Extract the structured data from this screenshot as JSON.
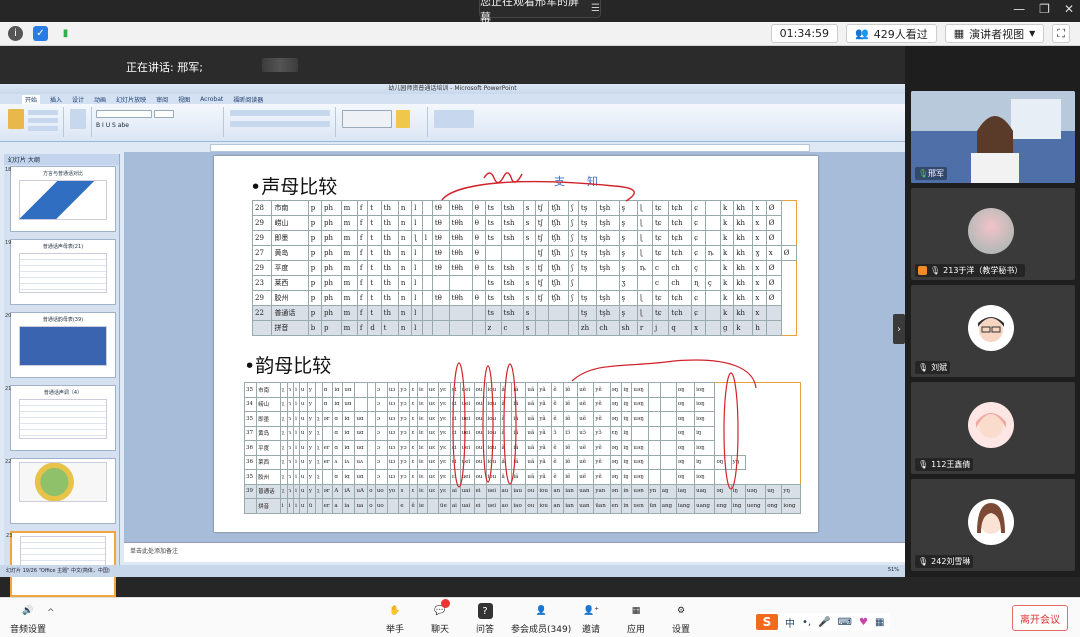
{
  "banner": {
    "text": "您正在观看邢军的屏幕"
  },
  "toolbar": {
    "timer": "01:34:59",
    "viewers": "429人看过",
    "view_mode": "演讲者视图"
  },
  "speaking": {
    "text": "正在讲话: 邢军;"
  },
  "ppt": {
    "window_title": "幼儿园师资普通话培训 - Microsoft PowerPoint",
    "tabs": [
      "开始",
      "插入",
      "设计",
      "动画",
      "幻灯片放映",
      "审阅",
      "视图",
      "Acrobat",
      "福昕阅读器"
    ],
    "pane_tabs": "幻灯片 大纲",
    "thumbnails": [
      {
        "num": "18",
        "title": "方言与普通话对比"
      },
      {
        "num": "19",
        "title": "普通话声母表(21)"
      },
      {
        "num": "20",
        "title": "普通话韵母表(39)"
      },
      {
        "num": "21",
        "title": "普通话声调（4）"
      },
      {
        "num": "22",
        "title": ""
      },
      {
        "num": "23",
        "title": ""
      }
    ],
    "notes": "单击此处添加备注",
    "status_left": "幻灯片 19/26   \"Office 主题\"   中文(简体，中国)",
    "status_right": "51%",
    "slide": {
      "title1": "•声母比较",
      "title2": "•韵母比较",
      "annot_zhi": "支",
      "annot_zhi2": "知",
      "table1": [
        [
          "28",
          "市南",
          "p",
          "ph",
          "m",
          "f",
          "t",
          "th",
          "n",
          "l",
          "",
          "tθ",
          "tθh",
          "θ",
          "ts",
          "tsh",
          "s",
          "tʃ",
          "tʃh",
          "ʃ",
          "tş",
          "tşh",
          "ş",
          "ɭ",
          "tɕ",
          "tɕh",
          "ɕ",
          "",
          "k",
          "kh",
          "x",
          "Ø"
        ],
        [
          "29",
          "崂山",
          "p",
          "ph",
          "m",
          "f",
          "t",
          "th",
          "n",
          "l",
          "",
          "tθ",
          "tθh",
          "θ",
          "ts",
          "tsh",
          "s",
          "tʃ",
          "tʃh",
          "ʃ",
          "tş",
          "tşh",
          "ş",
          "ɭ",
          "tɕ",
          "tɕh",
          "ɕ",
          "",
          "k",
          "kh",
          "x",
          "Ø"
        ],
        [
          "29",
          "即墨",
          "p",
          "ph",
          "m",
          "f",
          "t",
          "th",
          "n",
          "ɭ",
          "l",
          "tθ",
          "tθh",
          "θ",
          "ts",
          "tsh",
          "s",
          "tʃ",
          "tʃh",
          "ʃ",
          "tş",
          "tşh",
          "ş",
          "ɭ",
          "tɕ",
          "tɕh",
          "ɕ",
          "",
          "k",
          "kh",
          "x",
          "Ø"
        ],
        [
          "27",
          "黄岛",
          "p",
          "ph",
          "m",
          "f",
          "t",
          "th",
          "n",
          "l",
          "",
          "tθ",
          "tθh",
          "θ",
          "",
          "",
          "",
          "tʃ",
          "tʃh",
          "ʃ",
          "tş",
          "tşh",
          "ş",
          "ɭ",
          "tɕ",
          "tɕh",
          "ɕ",
          "ȵ",
          "k",
          "kh",
          "ɣ",
          "x",
          "Ø"
        ],
        [
          "29",
          "平度",
          "p",
          "ph",
          "m",
          "f",
          "t",
          "th",
          "n",
          "l",
          "",
          "tθ",
          "tθh",
          "θ",
          "ts",
          "tsh",
          "s",
          "tʃ",
          "tʃh",
          "ʃ",
          "tş",
          "tşh",
          "ş",
          "ȵ",
          "c",
          "ch",
          "ç",
          "",
          "k",
          "kh",
          "x",
          "Ø"
        ],
        [
          "23",
          "莱西",
          "p",
          "ph",
          "m",
          "f",
          "t",
          "th",
          "n",
          "l",
          "",
          "",
          "",
          "",
          "ts",
          "tsh",
          "s",
          "tʃ",
          "tʃh",
          "ʃ",
          "",
          "",
          "ʒ",
          "",
          "c",
          "ch",
          "ɳ",
          "ç",
          "k",
          "kh",
          "x",
          "Ø"
        ],
        [
          "29",
          "胶州",
          "p",
          "ph",
          "m",
          "f",
          "t",
          "th",
          "n",
          "l",
          "",
          "tθ",
          "tθh",
          "θ",
          "ts",
          "tsh",
          "s",
          "tʃ",
          "tʃh",
          "ʃ",
          "tş",
          "tşh",
          "ş",
          "ɭ",
          "tɕ",
          "tɕh",
          "ɕ",
          "",
          "k",
          "kh",
          "x",
          "Ø"
        ],
        [
          "22",
          "普通话",
          "p",
          "ph",
          "m",
          "f",
          "t",
          "th",
          "n",
          "l",
          "",
          "",
          "",
          "",
          "ts",
          "tsh",
          "s",
          "",
          "",
          "",
          "tş",
          "tşh",
          "ş",
          "ɭ",
          "tɕ",
          "tɕh",
          "ɕ",
          "",
          "k",
          "kh",
          "x",
          ""
        ],
        [
          "",
          "拼音",
          "b",
          "p",
          "m",
          "f",
          "d",
          "t",
          "n",
          "l",
          "",
          "",
          "",
          "",
          "z",
          "c",
          "s",
          "",
          "",
          "",
          "zh",
          "ch",
          "sh",
          "r",
          "j",
          "q",
          "x",
          "",
          "g",
          "k",
          "h",
          ""
        ]
      ],
      "table2": [
        [
          "35",
          "市南",
          "ʅ",
          "ɿ",
          "i",
          "u",
          "y",
          "",
          "ɑ",
          "iɑ",
          "uɑ",
          "",
          "",
          "ɔ",
          "uɔ",
          "yɔ",
          "ɛ",
          "iɛ",
          "uɛ",
          "yɛ",
          "ɛi",
          "uei",
          "ou",
          "iou",
          "ã",
          "iã",
          "uã",
          "yã",
          "ẽ",
          "iẽ",
          "uẽ",
          "yẽ",
          "əŋ",
          "iŋ",
          "uəŋ",
          "",
          "",
          "oŋ",
          "ioŋ"
        ],
        [
          "34",
          "崂山",
          "ʅ",
          "ɿ",
          "i",
          "u",
          "y",
          "",
          "ɑ",
          "iɑ",
          "uɑ",
          "",
          "",
          "ɔ",
          "uɔ",
          "yɔ",
          "ɛ",
          "iɛ",
          "uɛ",
          "yɛ",
          "ɛi",
          "uei",
          "ou",
          "iou",
          "ã",
          "iã",
          "uã",
          "yã",
          "ẽ",
          "iẽ",
          "uẽ",
          "yẽ",
          "əŋ",
          "iŋ",
          "uəŋ",
          "",
          "",
          "oŋ",
          "ioŋ"
        ],
        [
          "35",
          "即墨",
          "ʅ",
          "ɿ",
          "i",
          "u",
          "y",
          "ʅ",
          "ər",
          "ɑ",
          "iɑ",
          "uɑ",
          "",
          "ɔ",
          "uɔ",
          "yɔ",
          "ɛ",
          "iɛ",
          "uɛ",
          "yɛ",
          "ɛi",
          "uei",
          "ou",
          "iou",
          "ã",
          "iã",
          "uã",
          "yã",
          "ẽ",
          "iẽ",
          "uẽ",
          "yẽ",
          "əŋ",
          "iŋ",
          "uəŋ",
          "",
          "",
          "oŋ",
          "ioŋ"
        ],
        [
          "37",
          "黄岛",
          "ʅ",
          "ɿ",
          "i",
          "u",
          "y",
          "ʅ",
          "",
          "ɑ",
          "iɑ",
          "uɑ",
          "",
          "ɔ",
          "uɔ",
          "yɔ",
          "ɛ",
          "iɛ",
          "uɛ",
          "yɛ",
          "ɛi",
          "uei",
          "ou",
          "iou",
          "ã",
          "iã",
          "uã",
          "yã",
          "ɔ̃",
          "iɔ̃",
          "uɔ̃",
          "yɔ̃",
          "ɛŋ",
          "iŋ",
          "",
          "",
          "",
          "oŋ",
          "iŋ"
        ],
        [
          "36",
          "平度",
          "ʅ",
          "ɿ",
          "i",
          "u",
          "y",
          "ʅ",
          "er",
          "ɑ",
          "iɑ",
          "uɑ",
          "",
          "ɔ",
          "uɔ",
          "yɔ",
          "ɛ",
          "iɛ",
          "uɛ",
          "yɛ",
          "ɛi",
          "uei",
          "ou",
          "iou",
          "ã",
          "iã",
          "uã",
          "yã",
          "ẽ",
          "iẽ",
          "uẽ",
          "yẽ",
          "əŋ",
          "iŋ",
          "uəŋ",
          "",
          "",
          "oŋ",
          "ioŋ"
        ],
        [
          "36",
          "莱西",
          "ʅ",
          "ɿ",
          "i",
          "u",
          "y",
          "ʅ",
          "er",
          "ʌ",
          "iʌ",
          "uʌ",
          "",
          "ɔ",
          "uɔ",
          "yɔ",
          "ɛ",
          "iɛ",
          "uɛ",
          "yɛ",
          "ɛi",
          "uei",
          "ou",
          "iou",
          "ã",
          "iã",
          "uã",
          "yã",
          "ẽ",
          "iẽ",
          "uẽ",
          "yẽ",
          "əŋ",
          "iŋ",
          "uəŋ",
          "",
          "",
          "əŋ",
          "iŋ",
          "oŋ",
          "yŋ"
        ],
        [
          "35",
          "胶州",
          "ʅ",
          "ɿ",
          "i",
          "u",
          "y",
          "ʅ",
          "",
          "ɑ",
          "iɑ",
          "uɑ",
          "",
          "ɔ",
          "uɔ",
          "yɔ",
          "ɛ",
          "iɛ",
          "uɛ",
          "yɛ",
          "ɛi",
          "uei",
          "ou",
          "iou",
          "ã",
          "iã",
          "uã",
          "yã",
          "ẽ",
          "iẽ",
          "uẽ",
          "yẽ",
          "əŋ",
          "iŋ",
          "uəŋ",
          "",
          "",
          "oŋ",
          "ioŋ"
        ],
        [
          "39",
          "普通话",
          "ʅ",
          "ɿ",
          "i",
          "u",
          "y",
          "ʅ",
          "ər",
          "A",
          "iA",
          "uA",
          "o",
          "uo",
          "yo",
          "ɤ",
          "ɛ",
          "iɛ",
          "uɛ",
          "yɛ",
          "ai",
          "uai",
          "ei",
          "uei",
          "au",
          "iau",
          "ou",
          "iou",
          "an",
          "ian",
          "uan",
          "yan",
          "ən",
          "in",
          "uən",
          "yn",
          "aŋ",
          "iaŋ",
          "uaŋ",
          "əŋ",
          "iŋ",
          "uəŋ",
          "uŋ",
          "yŋ"
        ],
        [
          "",
          "拼音",
          "i",
          "i",
          "i",
          "u",
          "ü",
          "",
          "er",
          "a",
          "ia",
          "ua",
          "o",
          "uo",
          "",
          "e",
          "ê",
          "ie",
          "",
          "üe",
          "ai",
          "uai",
          "ei",
          "uei",
          "ao",
          "iao",
          "ou",
          "iou",
          "an",
          "ian",
          "uan",
          "üan",
          "en",
          "in",
          "uen",
          "ün",
          "ang",
          "iang",
          "uang",
          "eng",
          "ing",
          "ueng",
          "ong",
          "iong"
        ]
      ]
    }
  },
  "participants": [
    {
      "name": "邢军",
      "kind": "video"
    },
    {
      "name": "213于洋（教学秘书）",
      "kind": "avatar-flower"
    },
    {
      "name": "刘斌",
      "kind": "avatar-boy"
    },
    {
      "name": "112王鑫倩",
      "kind": "avatar-girl"
    },
    {
      "name": "242刘雪琳",
      "kind": "avatar-girl2"
    }
  ],
  "bottom": {
    "audio": "音频设置",
    "raise_hand": "举手",
    "chat": "聊天",
    "qa": "问答",
    "members": "参会成员(349)",
    "invite": "邀请",
    "apps": "应用",
    "settings": "设置",
    "leave": "离开会议",
    "ime_lang": "中"
  }
}
